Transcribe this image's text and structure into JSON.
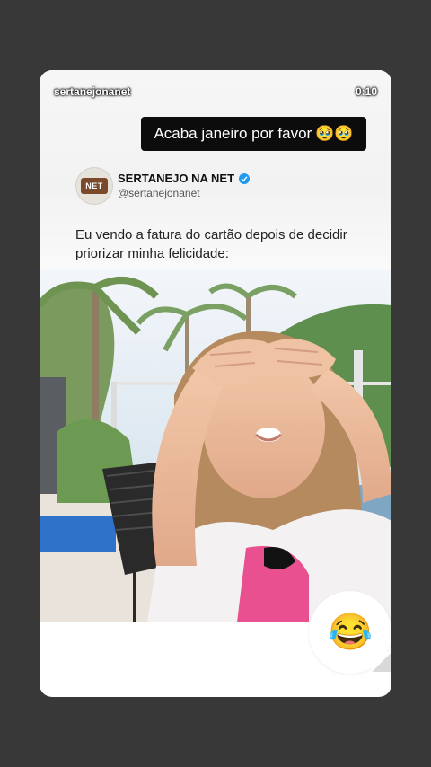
{
  "story": {
    "username": "sertanejonanet",
    "timestamp": "0:10"
  },
  "caption": {
    "text": "Acaba janeiro por favor",
    "emoji": "🥹🥹"
  },
  "post": {
    "account_name": "SERTANEJO NA NET",
    "handle": "@sertanejonanet",
    "avatar_text": "NET",
    "verified_color": "#1d9bf0",
    "text": "Eu vendo a fatura do cartão depois de decidir priorizar minha felicidade:"
  },
  "media": {
    "icon": "video-frame"
  },
  "reaction": {
    "emoji": "😂",
    "icon": "laughing-tears-emoji-icon"
  }
}
